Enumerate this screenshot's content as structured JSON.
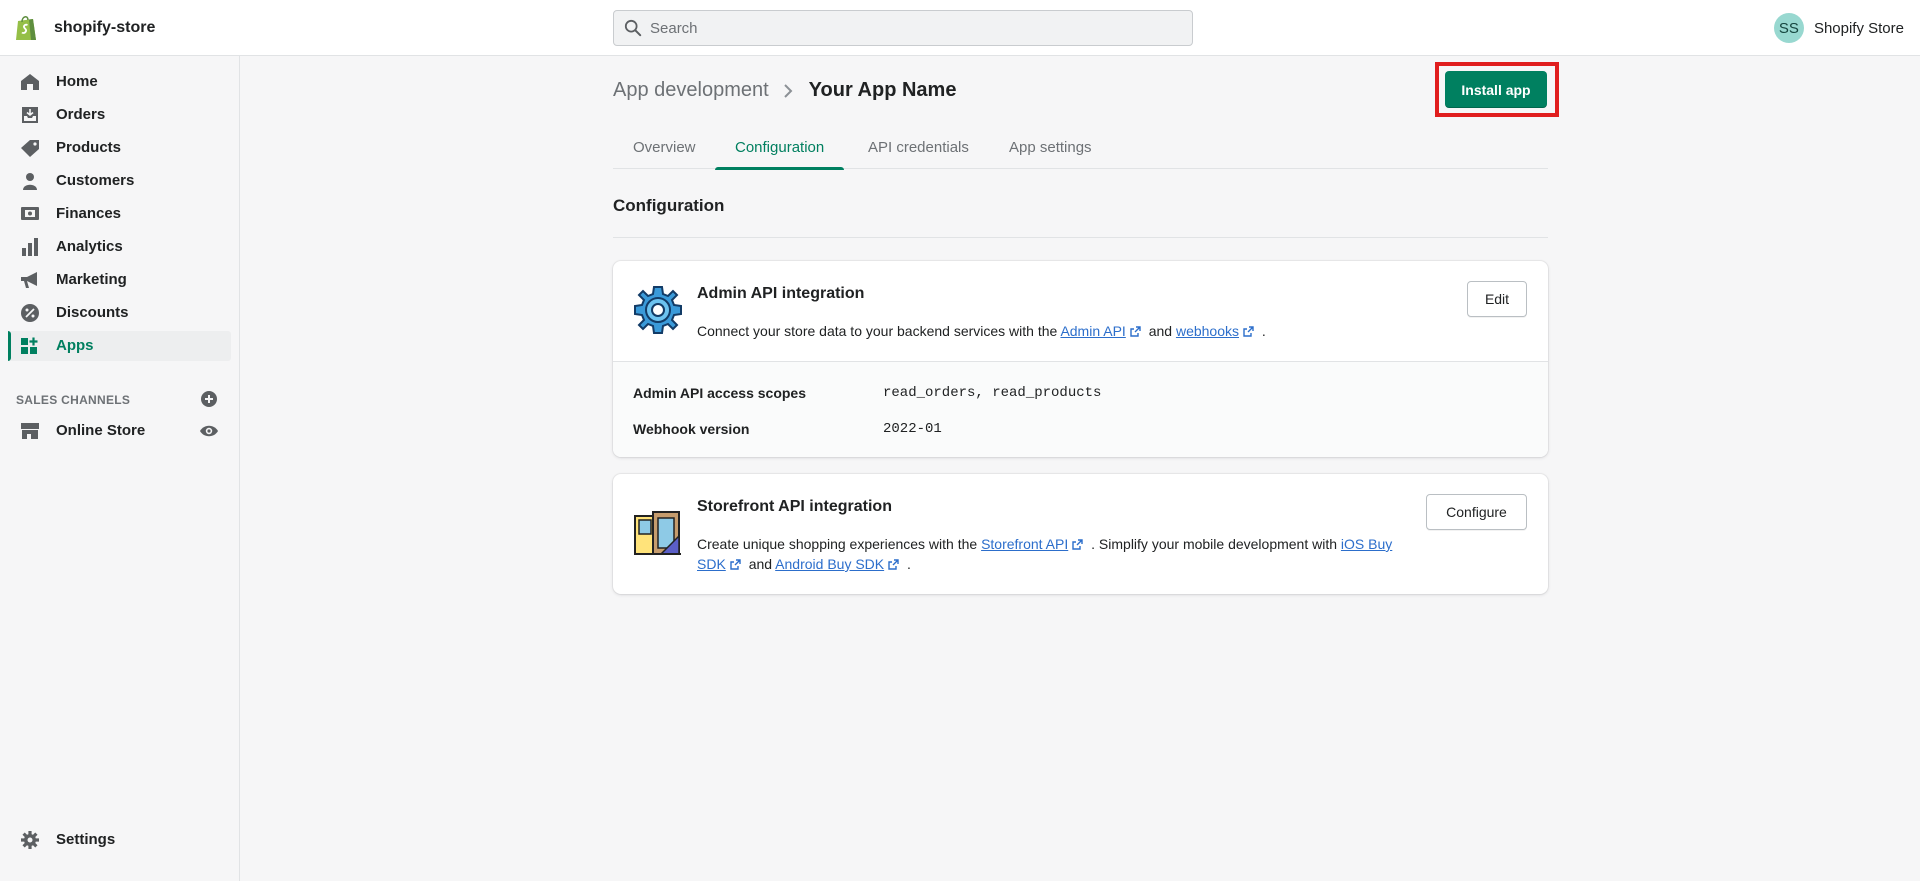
{
  "header": {
    "store_name": "shopify-store",
    "search_placeholder": "Search",
    "avatar_initials": "SS",
    "account_name": "Shopify Store",
    "logo_icon": "shopify-bag-icon"
  },
  "sidebar": {
    "items": [
      {
        "label": "Home",
        "icon": "home-icon"
      },
      {
        "label": "Orders",
        "icon": "orders-icon"
      },
      {
        "label": "Products",
        "icon": "tag-icon"
      },
      {
        "label": "Customers",
        "icon": "person-icon"
      },
      {
        "label": "Finances",
        "icon": "finances-icon"
      },
      {
        "label": "Analytics",
        "icon": "bar-chart-icon"
      },
      {
        "label": "Marketing",
        "icon": "megaphone-icon"
      },
      {
        "label": "Discounts",
        "icon": "discount-icon"
      },
      {
        "label": "Apps",
        "icon": "apps-icon",
        "active": true
      }
    ],
    "sales_channels_title": "SALES CHANNELS",
    "online_store_label": "Online Store",
    "settings_label": "Settings"
  },
  "breadcrumb": {
    "parent": "App development",
    "current": "Your App Name"
  },
  "install_button_label": "Install app",
  "tabs": [
    "Overview",
    "Configuration",
    "API credentials",
    "App settings"
  ],
  "active_tab": "Configuration",
  "section_heading": "Configuration",
  "admin_card": {
    "title": "Admin API integration",
    "desc_prefix": "Connect your store data to your backend services with the",
    "link_admin_api": "Admin API",
    "desc_and": "and",
    "link_webhooks": "webhooks",
    "desc_end": ".",
    "edit_label": "Edit",
    "scopes_label": "Admin API access scopes",
    "scopes_value": "read_orders, read_products",
    "webhook_label": "Webhook version",
    "webhook_value": "2022-01"
  },
  "storefront_card": {
    "title": "Storefront API integration",
    "desc_prefix": "Create unique shopping experiences with the",
    "link_storefront_api": "Storefront API",
    "desc_mid": ". Simplify your mobile development with",
    "link_ios_sdk": "iOS Buy SDK",
    "desc_and": "and",
    "link_android_sdk": "Android Buy SDK",
    "desc_end": ".",
    "configure_label": "Configure"
  },
  "colors": {
    "accent": "#008060",
    "highlight_border": "#e01e1e",
    "link": "#2c6ecb"
  }
}
